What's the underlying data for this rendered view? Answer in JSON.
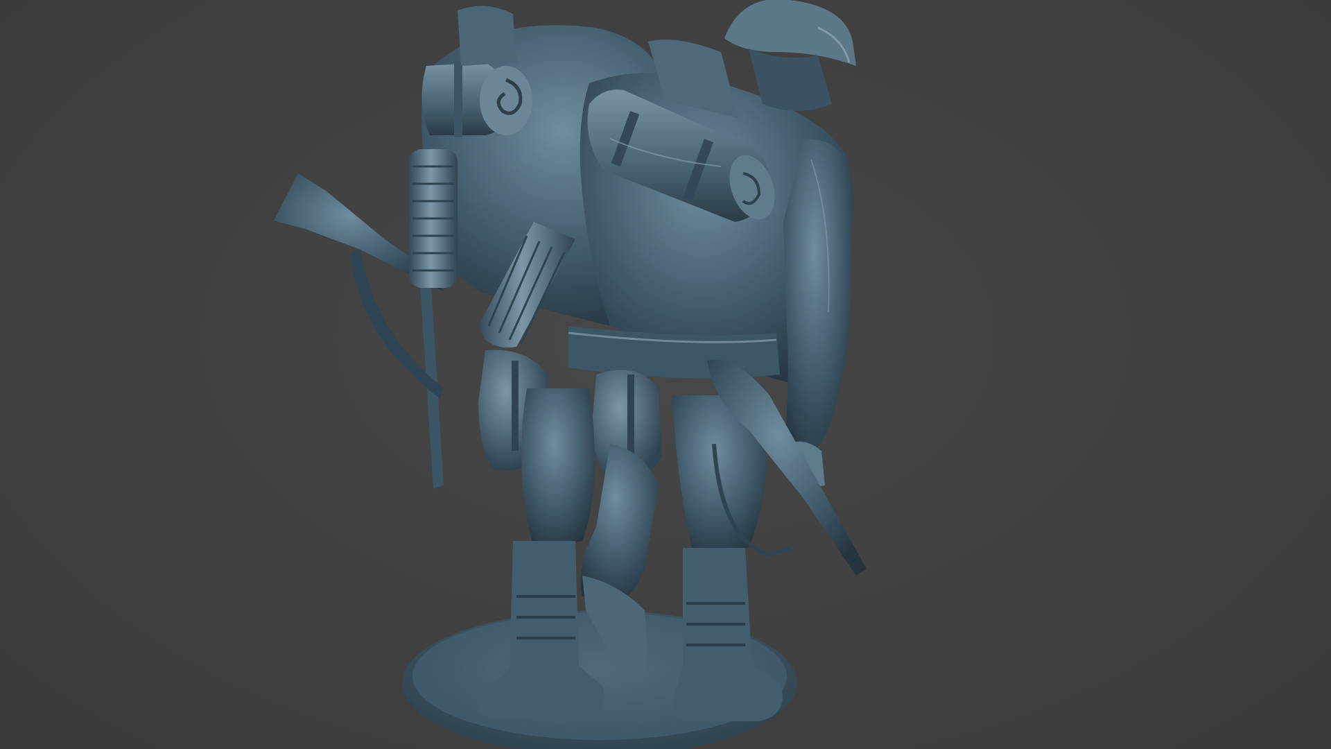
{
  "scene": {
    "background_color": "#414141",
    "model_color": "#3f5a6b",
    "model_highlight": "#6d8b9c",
    "model_shadow": "#22323c"
  },
  "objects": [
    "helmet-icon",
    "rolled-blanket-icon",
    "gas-mask-canister-icon",
    "rifle-icon",
    "canteen-icon",
    "boot-icon",
    "base-disc-icon"
  ]
}
